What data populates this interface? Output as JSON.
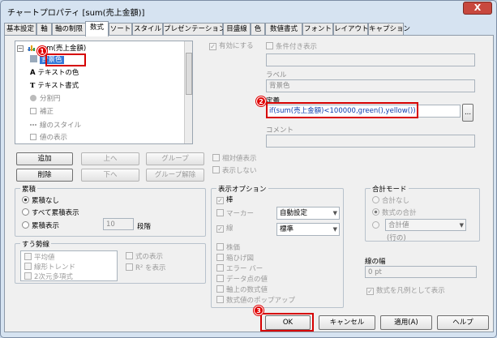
{
  "window": {
    "title": "チャートプロパティ [sum(売上金額)]",
    "close_label": "X"
  },
  "tabs": [
    "基本設定",
    "軸",
    "軸の制限",
    "数式",
    "ソート",
    "スタイル",
    "プレゼンテーション",
    "目盛線",
    "色",
    "数値書式",
    "フォント",
    "レイアウト",
    "キャプション"
  ],
  "active_tab": "数式",
  "tree": {
    "root": "sum(売上金額)",
    "items": [
      "背景色",
      "テキストの色",
      "テキスト書式",
      "分割円",
      "補正",
      "線のスタイル",
      "値の表示"
    ]
  },
  "buttons": {
    "add": "追加",
    "up": "上へ",
    "group": "グループ",
    "delete": "削除",
    "down": "下へ",
    "ungroup": "グループ解除",
    "ok": "OK",
    "cancel": "キャンセル",
    "apply": "適用(A)",
    "help": "ヘルプ",
    "ellipsis": "..."
  },
  "right": {
    "enable_label": "有効にする",
    "conditional_label": "条件付き表示",
    "label_caption": "ラベル",
    "label_value": "背景色",
    "definition_caption": "定義",
    "definition_value": "if(sum(売上金額)<100000,green(),yellow())",
    "comment_caption": "コメント"
  },
  "mid": {
    "relative": "相対値表示",
    "hide": "表示しない"
  },
  "accumulation": {
    "title": "累積",
    "none": "累積なし",
    "all": "すべて累積表示",
    "steps": "累積表示",
    "steps_value": "10",
    "steps_unit": "段階"
  },
  "trend": {
    "title": "すう勢線",
    "items": [
      "平均値",
      "線形トレンド",
      "2次元多項式"
    ],
    "show_formula": "式の表示",
    "show_r2": "R² を表示"
  },
  "display": {
    "title": "表示オプション",
    "bar": "棒",
    "marker": "マーカー",
    "marker_dd": "自動設定",
    "line": "線",
    "line_dd": "標準",
    "items": [
      "株価",
      "箱ひげ図",
      "エラー バー",
      "データ点の値",
      "軸上の数式値",
      "数式値のポップアップ"
    ]
  },
  "total": {
    "title": "合計モード",
    "none": "合計なし",
    "sum": "数式の合計",
    "dd_value": "合計値",
    "rows": "(行の)"
  },
  "line_width": {
    "title": "線の幅",
    "value": "0 pt"
  },
  "legend_chk": "数式を凡例として表示",
  "markers": [
    "1",
    "2",
    "3"
  ]
}
